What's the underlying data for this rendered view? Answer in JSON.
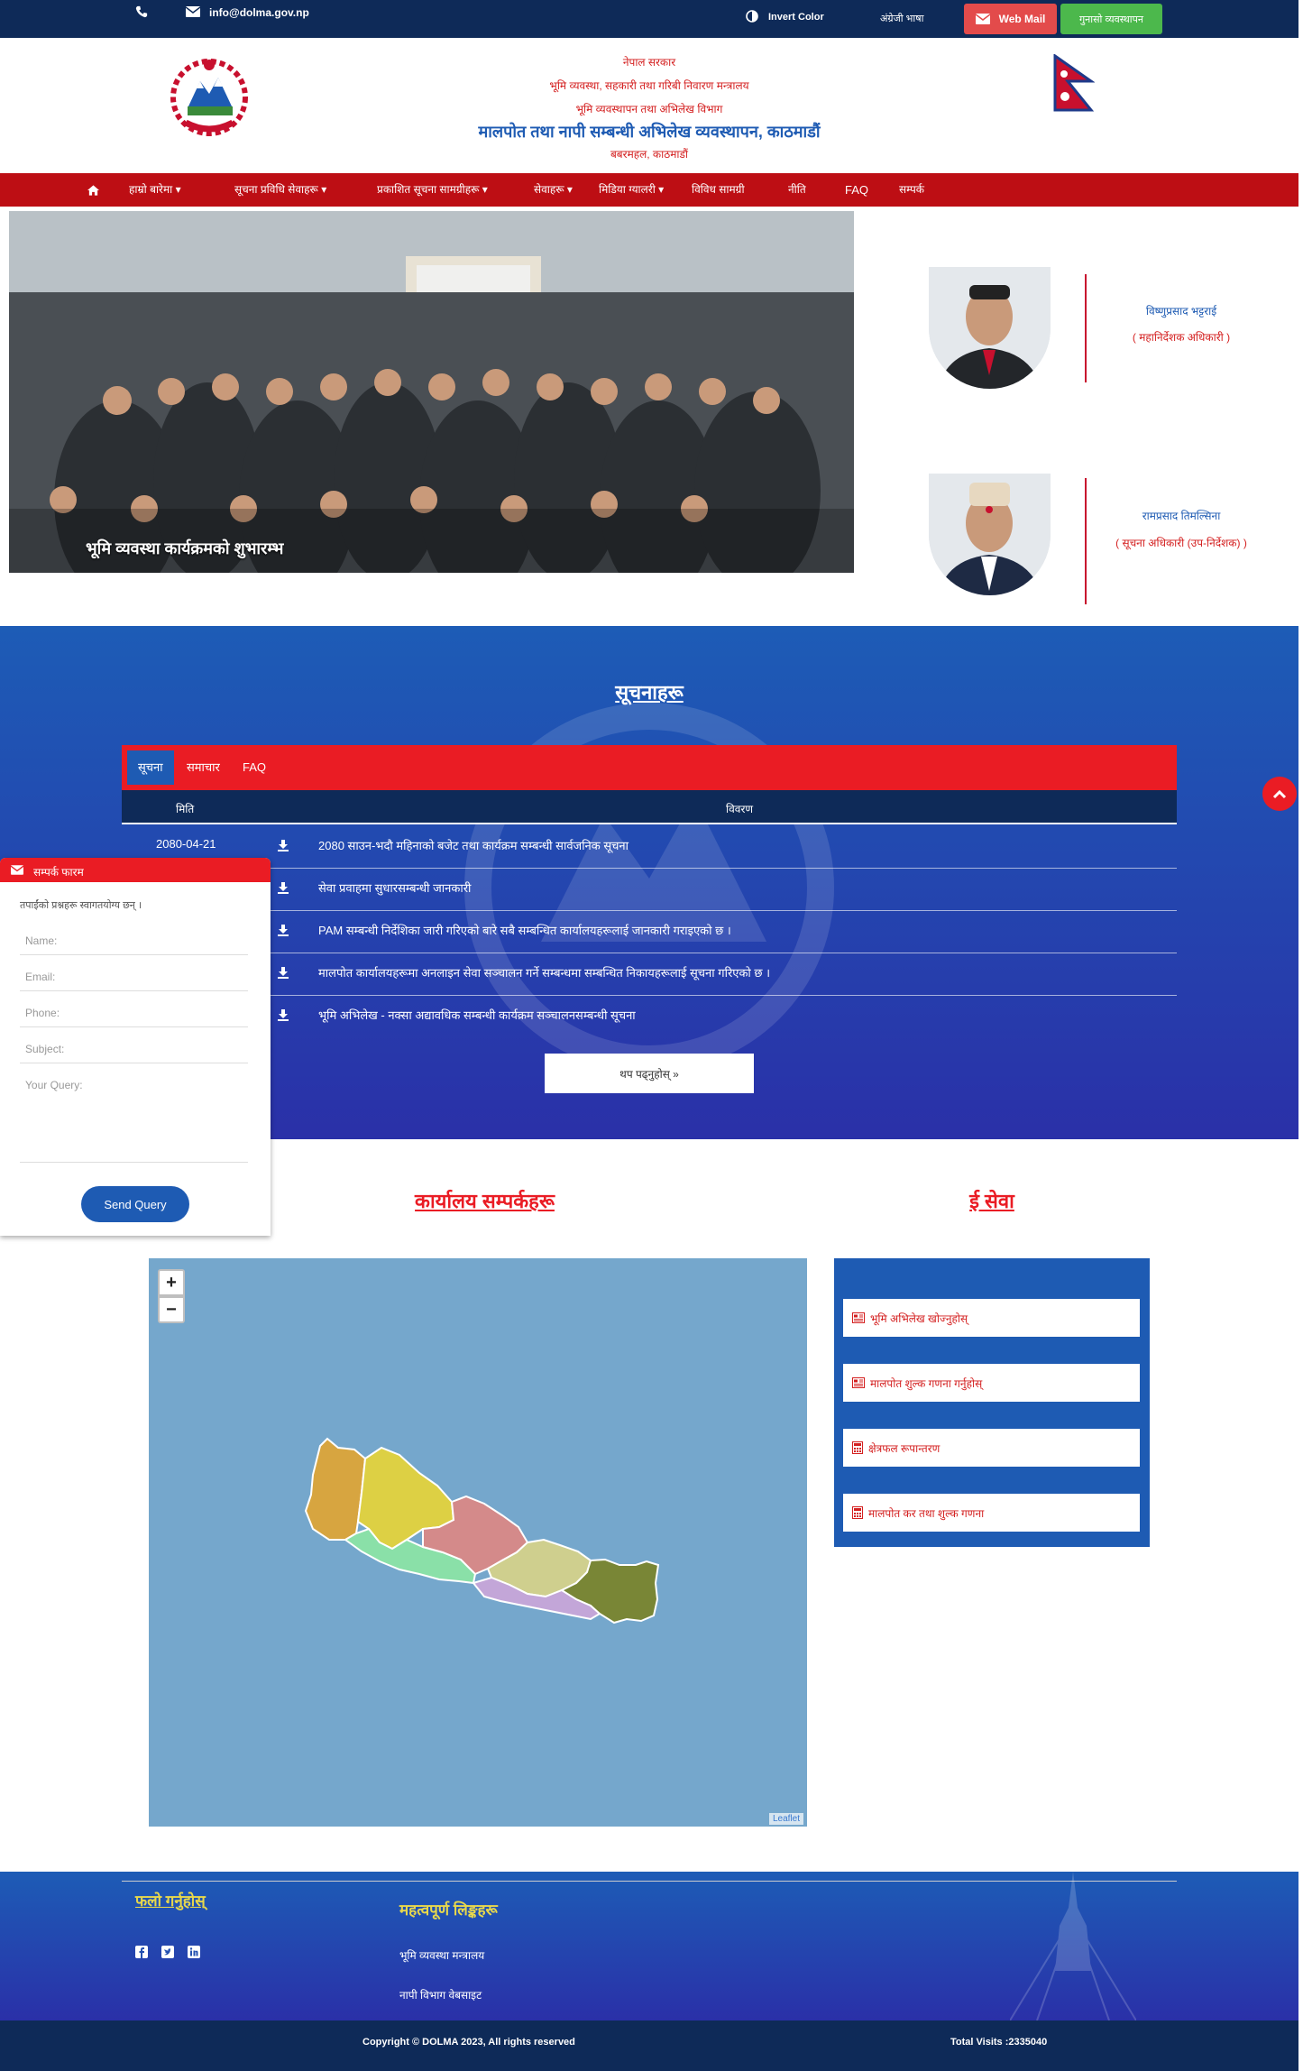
{
  "topbar": {
    "email": "info@dolma.gov.np",
    "invert_color": "Invert Color",
    "lang_switch": "अंग्रेजी भाषा",
    "webmail": "Web Mail",
    "grievance": "गुनासो व्यवस्थापन"
  },
  "header": {
    "line1": "नेपाल सरकार",
    "line2": "भूमि व्यवस्था, सहकारी तथा गरिबी निवारण मन्त्रालय",
    "line3": "भूमि व्यवस्थापन तथा अभिलेख विभाग",
    "title": "मालपोत तथा नापी सम्बन्धी अभिलेख व्यवस्थापन, काठमाडौं",
    "location": "बबरमहल, काठमाडौं"
  },
  "nav": {
    "items": [
      "हाम्रो बारेमा",
      "सूचना प्रविधि सेवाहरू",
      "प्रकाशित सूचना सामग्रीहरू",
      "सेवाहरू",
      "मिडिया ग्यालरी",
      "विविध सामग्री",
      "नीति",
      "FAQ",
      "सम्पर्क"
    ]
  },
  "hero": {
    "caption": "भूमि व्यवस्था कार्यक्रमको शुभारम्भ"
  },
  "officials": [
    {
      "name": "विष्णुप्रसाद भट्टराई",
      "role": "( महानिर्देशक अधिकारी )"
    },
    {
      "name": "रामप्रसाद तिमल्सिना",
      "role": "( सूचना अधिकारी (उप-निर्देशक) )"
    }
  ],
  "notice": {
    "heading": "सूचनाहरू",
    "tabs": [
      "सूचना",
      "समाचार",
      "FAQ"
    ],
    "col_date": "मिति",
    "col_title": "विवरण",
    "rows": [
      {
        "date": "2080-04-21",
        "title": "2080 साउन-भदौ महिनाको बजेट तथा कार्यक्रम सम्बन्धी सार्वजनिक सूचना"
      },
      {
        "date": "",
        "title": "सेवा प्रवाहमा सुधारसम्बन्धी जानकारी"
      },
      {
        "date": "",
        "title": "PAM सम्बन्धी निर्देशिका जारी गरिएको बारे सबै सम्बन्धित कार्यालयहरूलाई जानकारी गराइएको छ ।"
      },
      {
        "date": "",
        "title": "मालपोत कार्यालयहरूमा अनलाइन सेवा सञ्चालन गर्ने सम्बन्धमा सम्बन्धित निकायहरूलाई सूचना गरिएको छ ।"
      },
      {
        "date": "",
        "title": "भूमि अभिलेख - नक्सा अद्यावधिक सम्बन्धी कार्यक्रम सञ्चालनसम्बन्धी सूचना"
      }
    ],
    "more": "थप पढ्नुहोस् »"
  },
  "contact": {
    "title": "सम्पर्क फारम",
    "intro": "तपाईंको प्रश्नहरू स्वागतयोग्य छन् ।",
    "name_ph": "Name:",
    "email_ph": "Email:",
    "phone_ph": "Phone:",
    "subject_ph": "Subject:",
    "query_ph": "Your Query:",
    "send": "Send Query"
  },
  "sections": {
    "map_title": "कार्यालय सम्पर्कहरू",
    "links_title": "ई सेवा"
  },
  "map": {
    "zoom_in": "+",
    "zoom_out": "−",
    "attribution": "Leaflet",
    "province_colors": [
      "#d7a540",
      "#ddd044",
      "#8ae0a8",
      "#d48a8a",
      "#cfcf8e",
      "#c3a6d8",
      "#798636"
    ]
  },
  "eservices": [
    {
      "label": "भूमि अभिलेख खोज्नुहोस्",
      "icon": "newspaper-icon"
    },
    {
      "label": "मालपोत शुल्क गणना गर्नुहोस्",
      "icon": "newspaper-icon"
    },
    {
      "label": "क्षेत्रफल रूपान्तरण",
      "icon": "calculator-icon"
    },
    {
      "label": "मालपोत कर तथा शुल्क गणना",
      "icon": "calculator-icon"
    }
  ],
  "footer": {
    "follow_title": "फलो गर्नुहोस्",
    "links_title": "महत्वपूर्ण लिङ्कहरू",
    "links": [
      "भूमि व्यवस्था मन्त्रालय",
      "नापी विभाग वेबसाइट"
    ],
    "copyright": "Copyright © DOLMA 2023, All rights reserved",
    "visits": "Total Visits :2335040"
  }
}
